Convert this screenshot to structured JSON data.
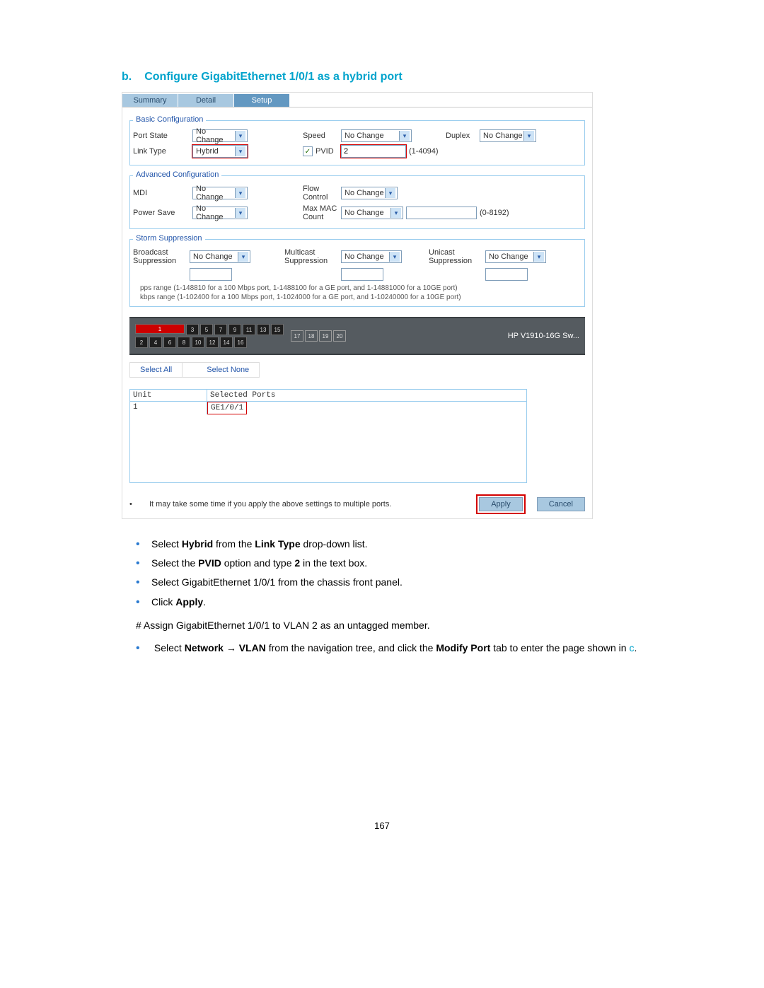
{
  "heading": {
    "marker": "b.",
    "title": "Configure GigabitEthernet 1/0/1 as a hybrid port"
  },
  "tabs": {
    "summary": "Summary",
    "detail": "Detail",
    "setup": "Setup"
  },
  "basic": {
    "legend": "Basic Configuration",
    "portStateLabel": "Port State",
    "portStateValue": "No Change",
    "speedLabel": "Speed",
    "speedValue": "No Change",
    "duplexLabel": "Duplex",
    "duplexValue": "No Change",
    "linkTypeLabel": "Link Type",
    "linkTypeValue": "Hybrid",
    "pvidLabel": "PVID",
    "pvidValue": "2",
    "pvidRange": "(1-4094)"
  },
  "adv": {
    "legend": "Advanced Configuration",
    "mdiLabel": "MDI",
    "mdiValue": "No Change",
    "flowLabel": "Flow Control",
    "flowValue": "No Change",
    "powerLabel": "Power Save",
    "powerValue": "No Change",
    "maxmacLabel": "Max MAC Count",
    "maxmacValue": "No Change",
    "maxmacRange": "(0-8192)"
  },
  "storm": {
    "legend": "Storm Suppression",
    "bcastLabel": "Broadcast Suppression",
    "bcastValue": "No Change",
    "mcastLabel": "Multicast Suppression",
    "mcastValue": "No Change",
    "ucastLabel": "Unicast Suppression",
    "ucastValue": "No Change",
    "note1": "pps range (1-148810 for a 100 Mbps port, 1-1488100 for a GE port, and 1-14881000 for a 10GE port)",
    "note2": "kbps range (1-102400 for a 100 Mbps port, 1-1024000 for a GE port, and 1-10240000 for a 10GE port)"
  },
  "chassis": {
    "topPorts": [
      "1",
      "3",
      "5",
      "7",
      "9",
      "11",
      "13",
      "15"
    ],
    "botPorts": [
      "2",
      "4",
      "6",
      "8",
      "10",
      "12",
      "14",
      "16"
    ],
    "auxPorts": [
      "17",
      "18",
      "19",
      "20"
    ],
    "selectedPort": "1",
    "deviceName": "HP V1910-16G Sw..."
  },
  "linkBtns": {
    "all": "Select All",
    "none": "Select None"
  },
  "spTable": {
    "hUnit": "Unit",
    "hSel": "Selected Ports",
    "unit": "1",
    "selected": "GE1/0/1"
  },
  "bottom": {
    "note": "It may take some time if you apply the above settings to multiple ports.",
    "apply": "Apply",
    "cancel": "Cancel"
  },
  "doc": {
    "b1a": "Select ",
    "b1b": "Hybrid",
    "b1c": " from the ",
    "b1d": "Link Type",
    "b1e": " drop-down list.",
    "b2a": "Select the ",
    "b2b": "PVID",
    "b2c": " option and type ",
    "b2d": "2",
    "b2e": " in the text box.",
    "b3": "Select GigabitEthernet 1/0/1 from the chassis front panel.",
    "b4a": "Click ",
    "b4b": "Apply",
    "b4c": ".",
    "hash": "# Assign GigabitEthernet 1/0/1 to VLAN 2 as an untagged member.",
    "b5a": "Select ",
    "b5b": "Network",
    "b5arrow": " → ",
    "b5c": "VLAN",
    "b5d": " from the navigation tree, and click the ",
    "b5e": "Modify Port",
    "b5f": " tab to enter the page shown in ",
    "b5g": "c",
    "b5h": "."
  },
  "pageNumber": "167"
}
